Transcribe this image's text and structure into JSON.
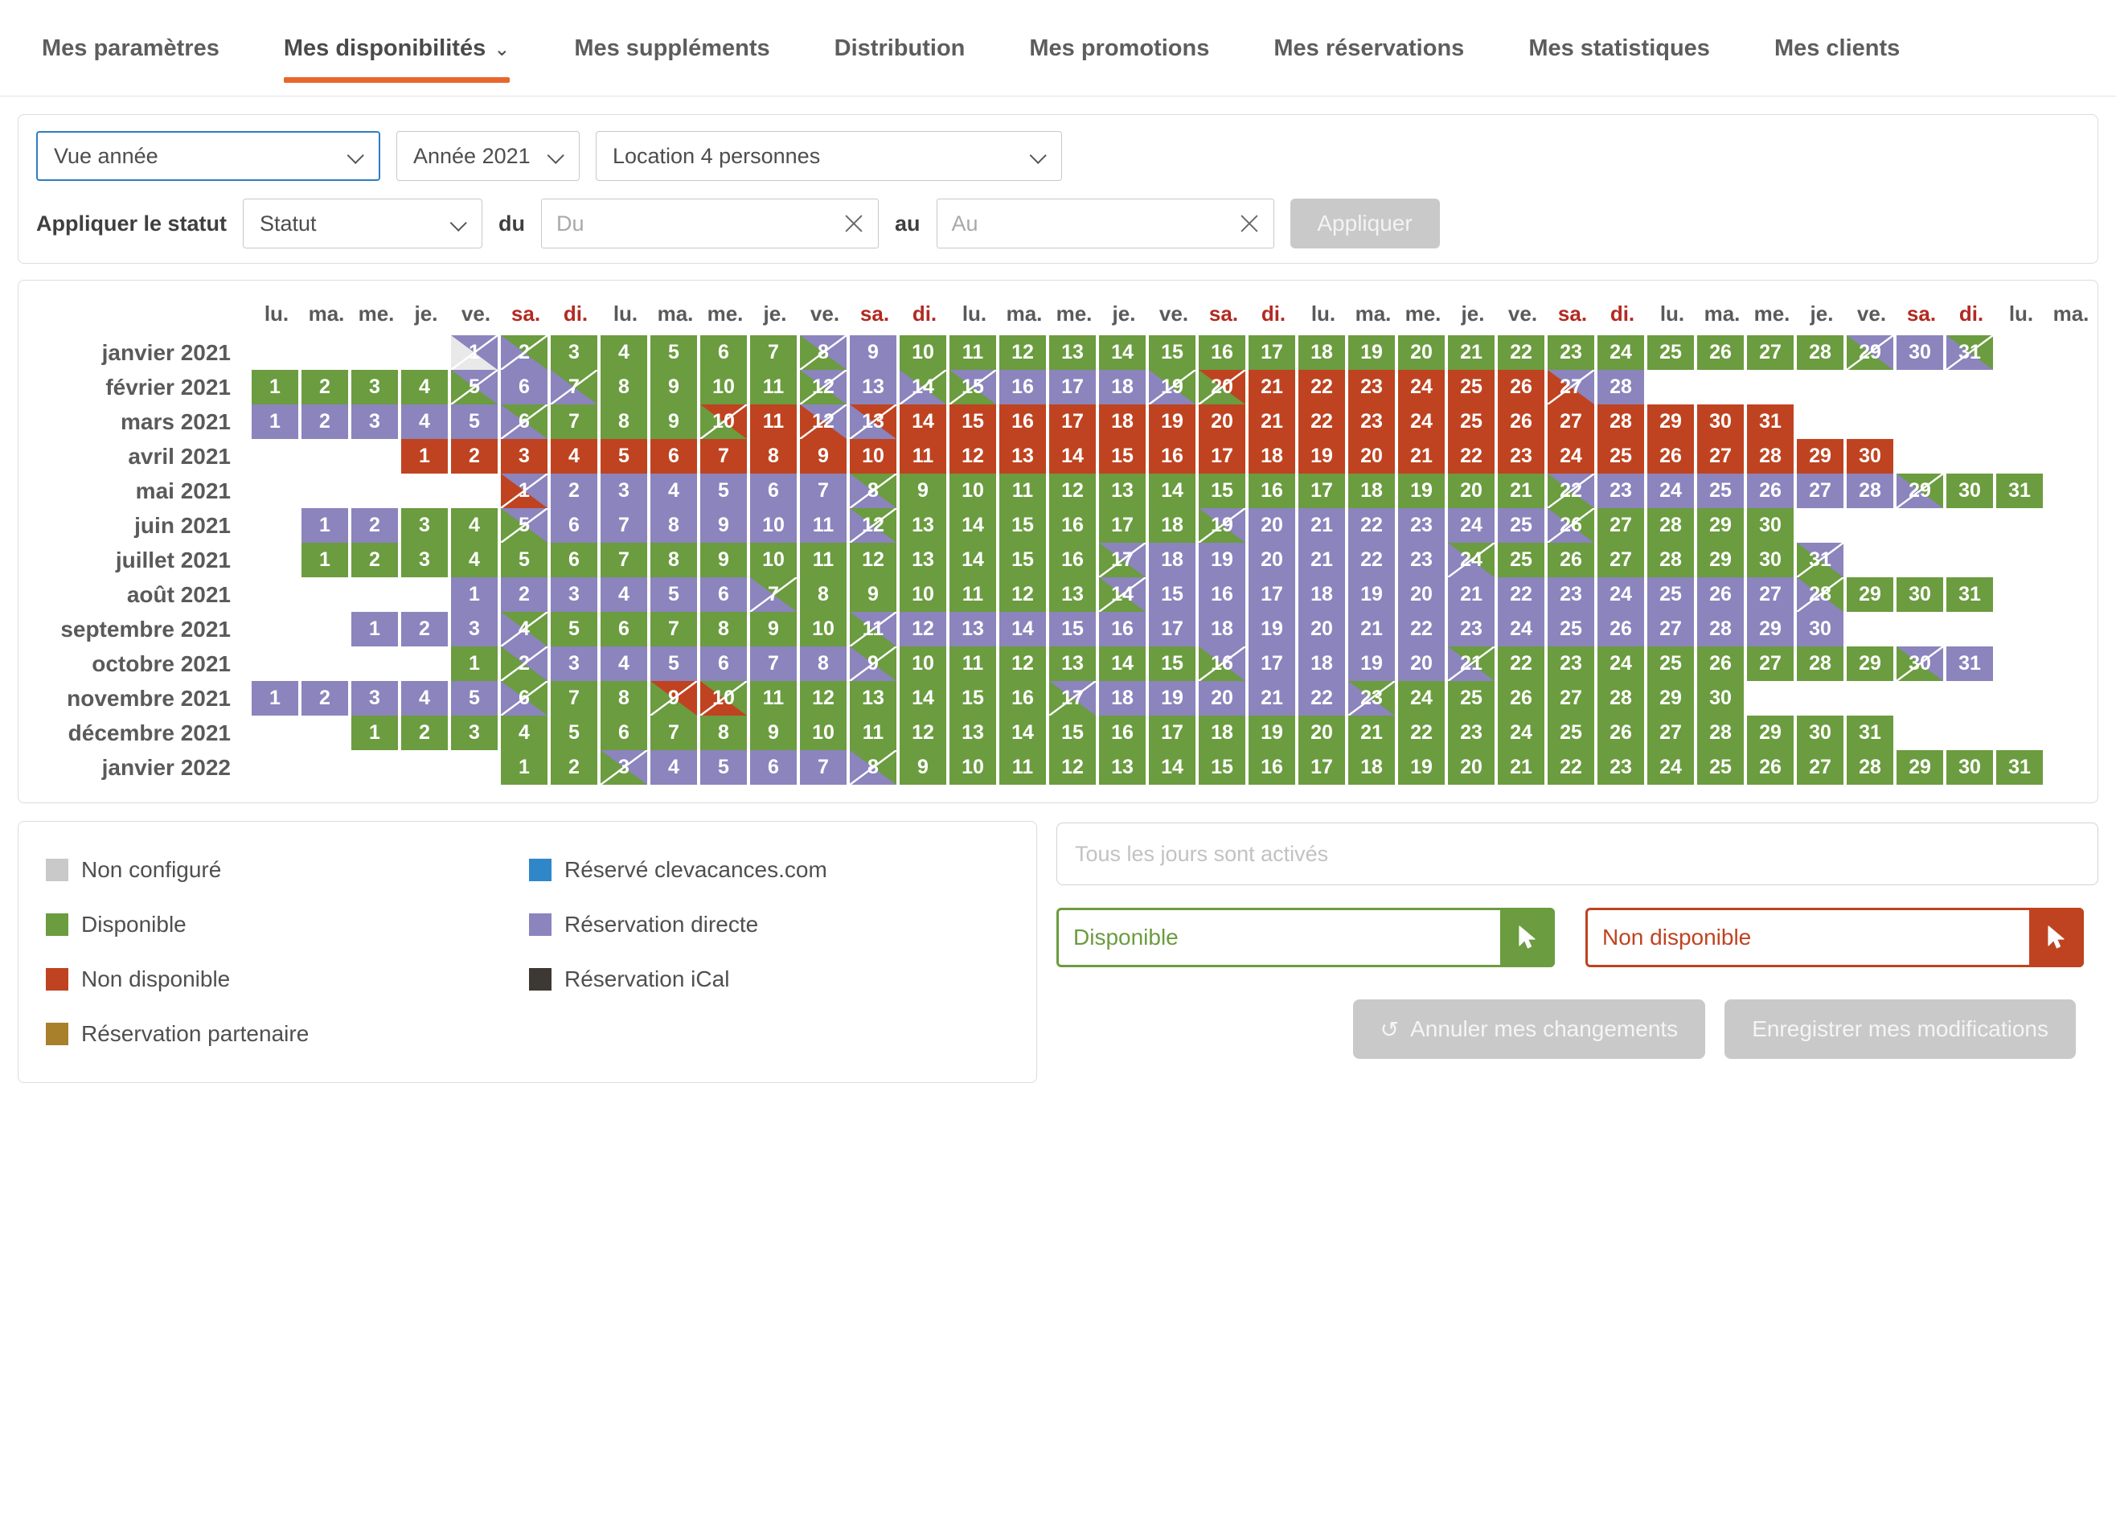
{
  "nav": {
    "tabs": [
      {
        "label": "Mes paramètres",
        "active": false,
        "caret": ""
      },
      {
        "label": "Mes disponibilités",
        "active": true,
        "caret": "⌄"
      },
      {
        "label": "Mes suppléments",
        "active": false,
        "caret": ""
      },
      {
        "label": "Distribution",
        "active": false,
        "caret": ""
      },
      {
        "label": "Mes promotions",
        "active": false,
        "caret": ""
      },
      {
        "label": "Mes réservations",
        "active": false,
        "caret": ""
      },
      {
        "label": "Mes statistiques",
        "active": false,
        "caret": ""
      },
      {
        "label": "Mes clients",
        "active": false,
        "caret": ""
      }
    ]
  },
  "filters": {
    "view_select": "Vue année",
    "year_select": "Année 2021",
    "accommodation_select": "Location 4 personnes",
    "apply_status_label": "Appliquer le statut",
    "status_select": "Statut",
    "from_label": "du",
    "from_placeholder": "Du",
    "from_value": "",
    "to_label": "au",
    "to_placeholder": "Au",
    "to_value": "",
    "apply_button": "Appliquer"
  },
  "calendar": {
    "weekday_headers": [
      "lu.",
      "ma.",
      "me.",
      "je.",
      "ve.",
      "sa.",
      "di.",
      "lu.",
      "ma.",
      "me.",
      "je.",
      "ve.",
      "sa.",
      "di.",
      "lu.",
      "ma.",
      "me.",
      "je.",
      "ve.",
      "sa.",
      "di.",
      "lu.",
      "ma.",
      "me.",
      "je.",
      "ve.",
      "sa.",
      "di.",
      "lu.",
      "ma.",
      "me.",
      "je.",
      "ve.",
      "sa.",
      "di.",
      "lu.",
      "ma."
    ],
    "weekend_indices": [
      5,
      6,
      12,
      13,
      19,
      20,
      26,
      27,
      33,
      34
    ],
    "status_colors": {
      "unconfigured": "#e9e9e9",
      "available": "#6b9c3f",
      "unavailable": "#bf4320",
      "direct": "#8b84bd",
      "clevacances": "#2f87c9",
      "ical": "#3d3833",
      "partner": "#a8802c"
    },
    "months": [
      {
        "label": "janvier 2021",
        "offset": 4,
        "days": 31,
        "states": [
          "unconfigured/direct",
          "direct/available",
          "available",
          "available",
          "available",
          "available",
          "available",
          "available/direct",
          "direct",
          "available",
          "available",
          "available",
          "available",
          "available",
          "available",
          "available",
          "available",
          "available",
          "available",
          "available",
          "available",
          "available",
          "available",
          "available",
          "available",
          "available",
          "available",
          "available",
          "available/direct",
          "direct",
          "direct/available"
        ]
      },
      {
        "label": "février 2021",
        "offset": 0,
        "days": 28,
        "states": [
          "available",
          "available",
          "available",
          "available",
          "available/direct",
          "direct",
          "direct/available",
          "available",
          "available",
          "available",
          "available",
          "available/direct",
          "direct",
          "direct/available",
          "available/direct",
          "direct",
          "direct",
          "direct",
          "direct/available",
          "available/unavailable",
          "unavailable",
          "unavailable",
          "unavailable",
          "unavailable",
          "unavailable",
          "unavailable",
          "unavailable/direct",
          "direct"
        ]
      },
      {
        "label": "mars 2021",
        "offset": 0,
        "days": 31,
        "states": [
          "direct",
          "direct",
          "direct",
          "direct",
          "direct",
          "direct/available",
          "available",
          "available",
          "available",
          "available/unavailable",
          "unavailable",
          "unavailable/direct",
          "direct/unavailable",
          "unavailable",
          "unavailable",
          "unavailable",
          "unavailable",
          "unavailable",
          "unavailable",
          "unavailable",
          "unavailable",
          "unavailable",
          "unavailable",
          "unavailable",
          "unavailable",
          "unavailable",
          "unavailable",
          "unavailable",
          "unavailable",
          "unavailable",
          "unavailable"
        ]
      },
      {
        "label": "avril 2021",
        "offset": 3,
        "days": 30,
        "states": [
          "unavailable",
          "unavailable",
          "unavailable",
          "unavailable",
          "unavailable",
          "unavailable",
          "unavailable",
          "unavailable",
          "unavailable",
          "unavailable",
          "unavailable",
          "unavailable",
          "unavailable",
          "unavailable",
          "unavailable",
          "unavailable",
          "unavailable",
          "unavailable",
          "unavailable",
          "unavailable",
          "unavailable",
          "unavailable",
          "unavailable",
          "unavailable",
          "unavailable",
          "unavailable",
          "unavailable",
          "unavailable",
          "unavailable",
          "unavailable"
        ]
      },
      {
        "label": "mai 2021",
        "offset": 5,
        "days": 31,
        "states": [
          "unavailable/direct",
          "direct",
          "direct",
          "direct",
          "direct",
          "direct",
          "direct",
          "direct/available",
          "available",
          "available",
          "available",
          "available",
          "available",
          "available",
          "available",
          "available",
          "available",
          "available",
          "available",
          "available",
          "available",
          "available/direct",
          "direct",
          "direct",
          "direct",
          "direct",
          "direct",
          "direct",
          "direct/available",
          "available",
          "available"
        ]
      },
      {
        "label": "juin 2021",
        "offset": 1,
        "days": 30,
        "states": [
          "direct",
          "direct",
          "available",
          "available",
          "available/direct",
          "direct",
          "direct",
          "direct",
          "direct",
          "direct",
          "direct",
          "direct/available",
          "available",
          "available",
          "available",
          "available",
          "available",
          "available",
          "available/direct",
          "direct",
          "direct",
          "direct",
          "direct",
          "direct",
          "direct",
          "direct/available",
          "available",
          "available",
          "available",
          "available"
        ]
      },
      {
        "label": "juillet 2021",
        "offset": 1,
        "days": 31,
        "states": [
          "available",
          "available",
          "available",
          "available",
          "available",
          "available",
          "available",
          "available",
          "available",
          "available",
          "available",
          "available",
          "available",
          "available",
          "available",
          "available",
          "available/direct",
          "direct",
          "direct",
          "direct",
          "direct",
          "direct",
          "direct",
          "direct/available",
          "available",
          "available",
          "available",
          "available",
          "available",
          "available",
          "available/direct"
        ]
      },
      {
        "label": "août 2021",
        "offset": 4,
        "days": 31,
        "states": [
          "direct",
          "direct",
          "direct",
          "direct",
          "direct",
          "direct",
          "direct/available",
          "available",
          "available",
          "available",
          "available",
          "available",
          "available",
          "available/direct",
          "direct",
          "direct",
          "direct",
          "direct",
          "direct",
          "direct",
          "direct",
          "direct",
          "direct",
          "direct",
          "direct",
          "direct",
          "direct",
          "direct/available",
          "available",
          "available",
          "available"
        ]
      },
      {
        "label": "septembre 2021",
        "offset": 2,
        "days": 30,
        "states": [
          "direct",
          "direct",
          "direct",
          "direct/available",
          "available",
          "available",
          "available",
          "available",
          "available",
          "available",
          "available/direct",
          "direct",
          "direct",
          "direct",
          "direct",
          "direct",
          "direct",
          "direct",
          "direct",
          "direct",
          "direct",
          "direct",
          "direct",
          "direct",
          "direct",
          "direct",
          "direct",
          "direct",
          "direct",
          "direct"
        ]
      },
      {
        "label": "octobre 2021",
        "offset": 4,
        "days": 31,
        "states": [
          "available",
          "available/direct",
          "direct",
          "direct",
          "direct",
          "direct",
          "direct",
          "direct",
          "direct/available",
          "available",
          "available",
          "available",
          "available",
          "available",
          "available",
          "available/direct",
          "direct",
          "direct",
          "direct",
          "direct",
          "direct/available",
          "available",
          "available",
          "available",
          "available",
          "available",
          "available",
          "available",
          "available",
          "available/direct",
          "direct"
        ]
      },
      {
        "label": "novembre 2021",
        "offset": 0,
        "days": 30,
        "states": [
          "direct",
          "direct",
          "direct",
          "direct",
          "direct",
          "direct/available",
          "available",
          "available",
          "available/unavailable",
          "unavailable/available",
          "available",
          "available",
          "available",
          "available",
          "available",
          "available",
          "available/direct",
          "direct",
          "direct",
          "direct",
          "direct",
          "direct",
          "direct/available",
          "available",
          "available",
          "available",
          "available",
          "available",
          "available",
          "available"
        ]
      },
      {
        "label": "décembre 2021",
        "offset": 2,
        "days": 31,
        "states": [
          "available",
          "available",
          "available",
          "available",
          "available",
          "available",
          "available",
          "available",
          "available",
          "available",
          "available",
          "available",
          "available",
          "available",
          "available",
          "available",
          "available",
          "available",
          "available",
          "available",
          "available",
          "available",
          "available",
          "available",
          "available",
          "available",
          "available",
          "available",
          "available",
          "available",
          "available"
        ]
      },
      {
        "label": "janvier 2022",
        "offset": 5,
        "days": 31,
        "states": [
          "available",
          "available",
          "available/direct",
          "direct",
          "direct",
          "direct",
          "direct",
          "direct/available",
          "available",
          "available",
          "available",
          "available",
          "available",
          "available",
          "available",
          "available",
          "available",
          "available",
          "available",
          "available",
          "available",
          "available",
          "available",
          "available",
          "available",
          "available",
          "available",
          "available",
          "available",
          "available",
          "available"
        ]
      }
    ]
  },
  "legend": {
    "left": [
      {
        "label": "Non configuré",
        "color": "#c9c9c9"
      },
      {
        "label": "Disponible",
        "color": "#6b9c3f"
      },
      {
        "label": "Non disponible",
        "color": "#bf4320"
      },
      {
        "label": "Réservation partenaire",
        "color": "#a8802c"
      }
    ],
    "right": [
      {
        "label": "Réservé clevacances.com",
        "color": "#2f87c9"
      },
      {
        "label": "Réservation directe",
        "color": "#8b84bd"
      },
      {
        "label": "Réservation iCal",
        "color": "#3d3833"
      }
    ]
  },
  "right_pane": {
    "days_enabled_text": "Tous les jours sont activés",
    "available_button": "Disponible",
    "unavailable_button": "Non disponible"
  },
  "actions": {
    "cancel_button": "Annuler mes changements",
    "cancel_icon": "↺",
    "save_button": "Enregistrer mes modifications"
  }
}
